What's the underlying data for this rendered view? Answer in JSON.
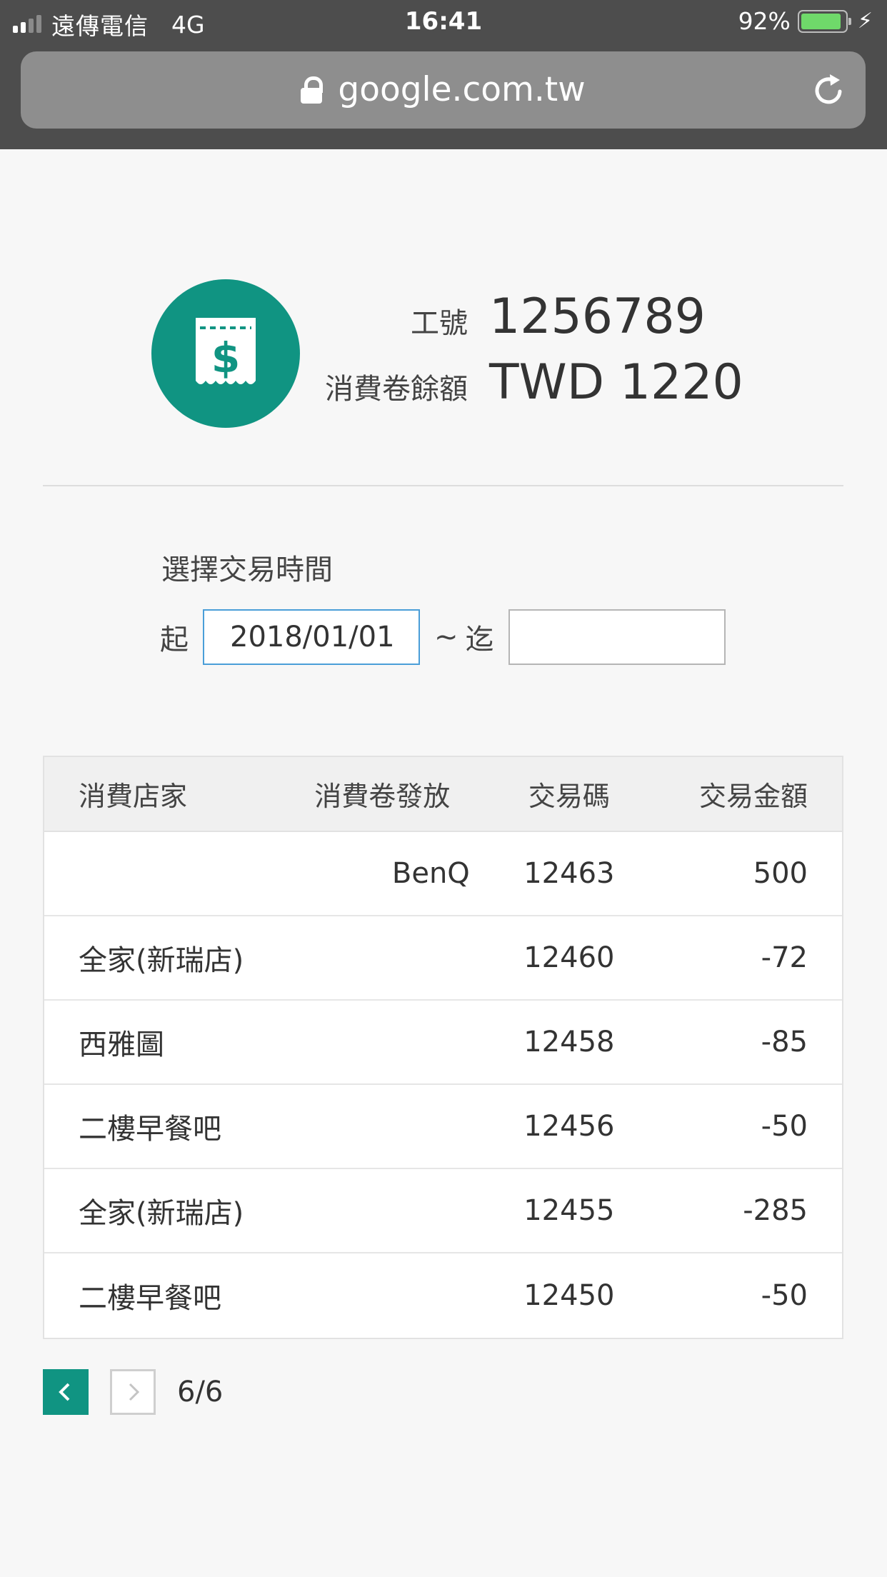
{
  "status_bar": {
    "carrier": "遠傳電信",
    "network": "4G",
    "time": "16:41",
    "battery": "92%",
    "battery_level": 0.92
  },
  "browser": {
    "url": "google.com.tw"
  },
  "profile": {
    "id_label": "工號",
    "id_value": "1256789",
    "balance_label": "消費卷餘額",
    "balance_value": "TWD 1220",
    "accent_color": "#109482"
  },
  "filter": {
    "title": "選擇交易時間",
    "from_label": "起",
    "from_value": "2018/01/01",
    "separator": "~",
    "to_label": "迄",
    "to_value": ""
  },
  "table": {
    "headers": [
      "消費店家",
      "消費卷發放",
      "交易碼",
      "交易金額"
    ],
    "rows": [
      {
        "store": "",
        "issuer": "BenQ",
        "code": "12463",
        "amount": "500"
      },
      {
        "store": "全家(新瑞店)",
        "issuer": "",
        "code": "12460",
        "amount": "-72"
      },
      {
        "store": "西雅圖",
        "issuer": "",
        "code": "12458",
        "amount": "-85"
      },
      {
        "store": "二樓早餐吧",
        "issuer": "",
        "code": "12456",
        "amount": "-50"
      },
      {
        "store": "全家(新瑞店)",
        "issuer": "",
        "code": "12455",
        "amount": "-285"
      },
      {
        "store": "二樓早餐吧",
        "issuer": "",
        "code": "12450",
        "amount": "-50"
      }
    ]
  },
  "pagination": {
    "page_text": "6/6"
  },
  "icons": {
    "badge": "receipt-dollar-icon",
    "prev": "chevron-left-icon",
    "next": "chevron-right-icon",
    "lock": "lock-icon",
    "reload": "reload-icon"
  }
}
